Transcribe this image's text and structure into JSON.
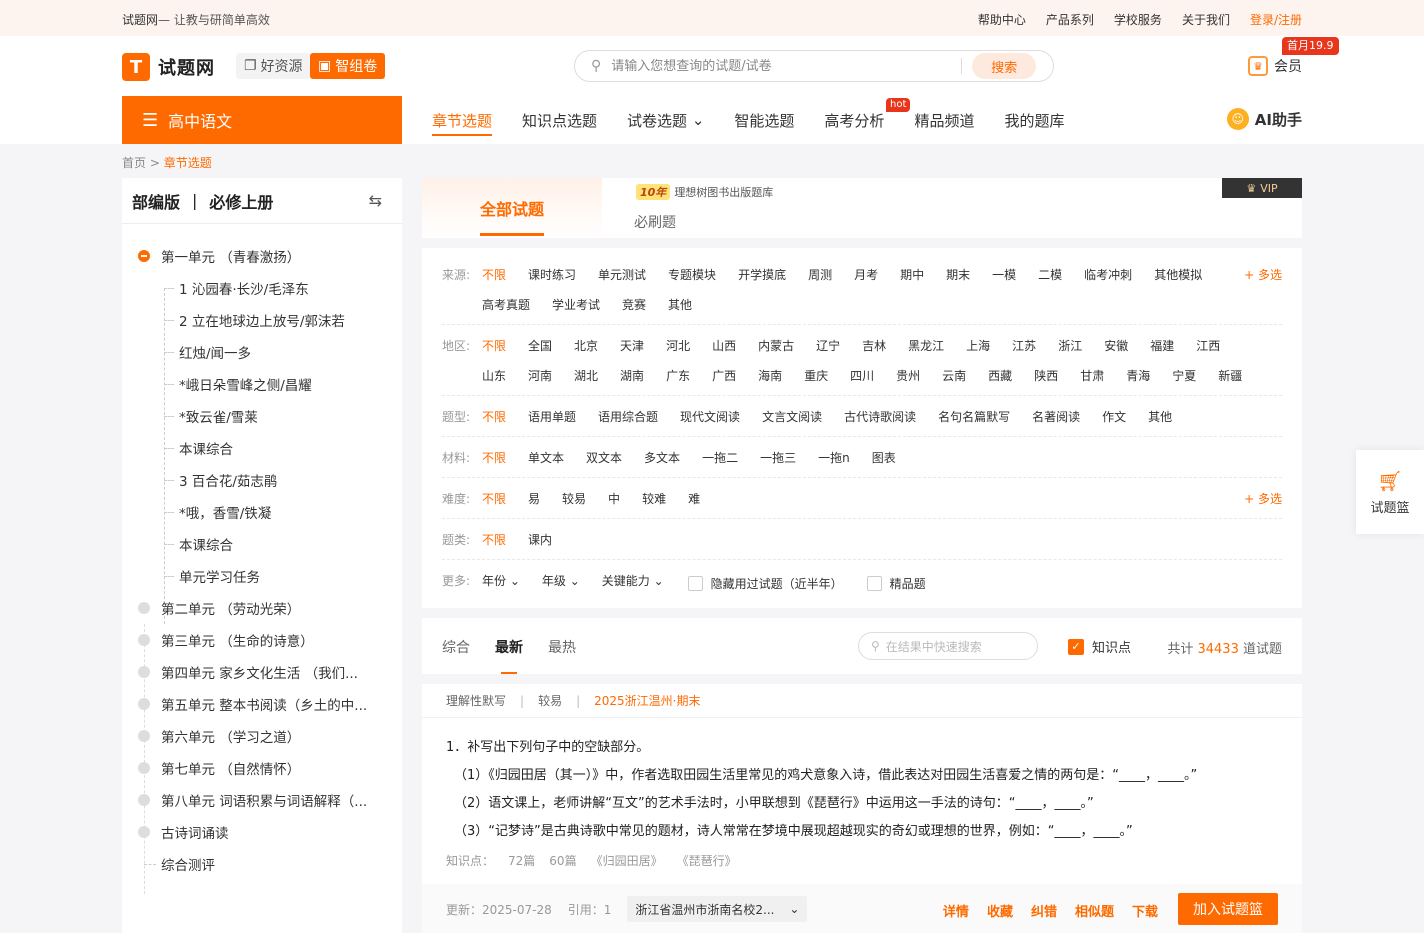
{
  "topbar": {
    "brand": "试题网",
    "slogan": "— 让教与研简单高效",
    "links": [
      "帮助中心",
      "产品系列",
      "学校服务",
      "关于我们"
    ],
    "login": "登录/注册"
  },
  "header": {
    "logo_mark": "T",
    "logo_text": "试题网",
    "good_res": "好资源",
    "smart_paper": "智组卷",
    "search_placeholder": "请输入您想查询的试题/试卷",
    "search_button": "搜索",
    "member_label": "会员",
    "member_badge": "首月19.9",
    "subject": "高中语文",
    "nav": [
      {
        "label": "章节选题",
        "active": true
      },
      {
        "label": "知识点选题"
      },
      {
        "label": "试卷选题",
        "dropdown": "⌄"
      },
      {
        "label": "智能选题"
      },
      {
        "label": "高考分析",
        "badge": "hot"
      },
      {
        "label": "精品频道"
      },
      {
        "label": "我的题库"
      }
    ],
    "ai": "AI助手"
  },
  "breadcrumb": {
    "home": "首页",
    "sep": ">",
    "current": "章节选题"
  },
  "sidebar": {
    "edition": "部编版",
    "sep": "|",
    "book": "必修上册",
    "units": [
      "第一单元 （青春激扬）",
      "第二单元 （劳动光荣）",
      "第三单元 （生命的诗意）",
      "第四单元 家乡文化生活 （我们...",
      "第五单元 整本书阅读（乡土的中...",
      "第六单元 （学习之道）",
      "第七单元 （自然情怀）",
      "第八单元 词语积累与词语解释（...",
      "古诗词诵读"
    ],
    "leaves": [
      "1 沁园春·长沙/毛泽东",
      "2 立在地球边上放号/郭沫若",
      "红烛/闻一多",
      "*峨日朵雪峰之侧/昌耀",
      "*致云雀/雪莱",
      "本课综合",
      "3 百合花/茹志鹃",
      "*哦，香雪/铁凝",
      "本课综合",
      "单元学习任务"
    ],
    "last": "综合测评"
  },
  "maintabs": {
    "all": "全部试题",
    "brand_tag": "10年",
    "brand_sub": "理想树图书出版题库",
    "brush": "必刷题",
    "vip": "VIP"
  },
  "filters": {
    "source": {
      "label": "来源:",
      "options": [
        "不限",
        "课时练习",
        "单元测试",
        "专题模块",
        "开学摸底",
        "周测",
        "月考",
        "期中",
        "期末",
        "一模",
        "二模",
        "临考冲刺",
        "其他模拟",
        "高考真题",
        "学业考试",
        "竞赛",
        "其他"
      ],
      "more": "+ 多选"
    },
    "region": {
      "label": "地区:",
      "options": [
        "不限",
        "全国",
        "北京",
        "天津",
        "河北",
        "山西",
        "内蒙古",
        "辽宁",
        "吉林",
        "黑龙江",
        "上海",
        "江苏",
        "浙江",
        "安徽",
        "福建",
        "江西",
        "山东",
        "河南",
        "湖北",
        "湖南",
        "广东",
        "广西",
        "海南",
        "重庆",
        "四川",
        "贵州",
        "云南",
        "西藏",
        "陕西",
        "甘肃",
        "青海",
        "宁夏",
        "新疆"
      ]
    },
    "qtype": {
      "label": "题型:",
      "options": [
        "不限",
        "语用单题",
        "语用综合题",
        "现代文阅读",
        "文言文阅读",
        "古代诗歌阅读",
        "名句名篇默写",
        "名著阅读",
        "作文",
        "其他"
      ]
    },
    "material": {
      "label": "材料:",
      "options": [
        "不限",
        "单文本",
        "双文本",
        "多文本",
        "一拖二",
        "一拖三",
        "一拖n",
        "图表"
      ]
    },
    "difficulty": {
      "label": "难度:",
      "options": [
        "不限",
        "易",
        "较易",
        "中",
        "较难",
        "难"
      ],
      "more": "+ 多选"
    },
    "category": {
      "label": "题类:",
      "options": [
        "不限",
        "课内"
      ]
    },
    "more": {
      "label": "更多:",
      "dropdowns": [
        "年份 ⌄",
        "年级 ⌄",
        "关键能力 ⌄"
      ],
      "check1": "隐藏用过试题（近半年）",
      "check2": "精品题"
    }
  },
  "sortbar": {
    "tabs": [
      "综合",
      "最新",
      "最热"
    ],
    "quick_placeholder": "在结果中快速搜索",
    "knowledge": "知识点",
    "total_prefix": "共计",
    "total": "34433",
    "total_suffix": "道试题"
  },
  "question": {
    "type": "理解性默写",
    "level": "较易",
    "source": "2025浙江温州·期末",
    "stem": "1．补写出下列句子中的空缺部分。",
    "parts": [
      "（1）《归园田居（其一）》中，作者选取田园生活里常见的鸡犬意象入诗，借此表达对田园生活喜爱之情的两句是：“____，____。”",
      "（2）语文课上，老师讲解“互文”的艺术手法时，小甲联想到《琵琶行》中运用这一手法的诗句：“____，____。”",
      "（3）“记梦诗”是古典诗歌中常见的题材，诗人常常在梦境中展现超越现实的奇幻或理想的世界，例如：“____，____。”"
    ],
    "kp_label": "知识点：",
    "kp_count": "72篇",
    "kp_count2": "60篇",
    "kp_items": [
      "《归园田居》",
      "《琵琶行》"
    ],
    "updated": "更新：2025-07-28",
    "quoted": "引用：1",
    "school": "浙江省温州市浙南名校2...",
    "actions": [
      "详情",
      "收藏",
      "纠错",
      "相似题",
      "下载"
    ],
    "add": "加入试题篮"
  },
  "basket": {
    "label": "试题篮"
  },
  "colors": {
    "accent": "#ff6a00"
  }
}
